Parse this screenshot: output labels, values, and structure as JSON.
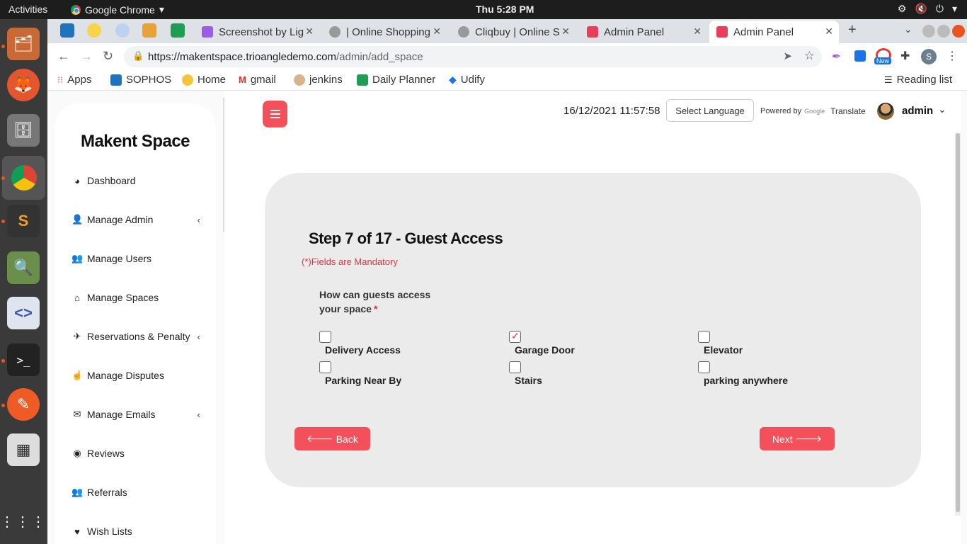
{
  "os": {
    "activities_label": "Activities",
    "app_name": "Google Chrome",
    "clock": "Thu  5:28 PM"
  },
  "browser": {
    "tabs": [
      {
        "label": "Screenshot by Lig"
      },
      {
        "label": "| Online Shopping"
      },
      {
        "label": "Cliqbuy | Online S"
      },
      {
        "label": "Admin Panel"
      },
      {
        "label": "Admin Panel"
      }
    ],
    "url_host": "https://makentspace.trioangledemo.com",
    "url_path": "/admin/add_space",
    "bookmarks": [
      {
        "label": "Apps"
      },
      {
        "label": "SOPHOS"
      },
      {
        "label": "Home"
      },
      {
        "label": "gmail"
      },
      {
        "label": "jenkins"
      },
      {
        "label": "Daily Planner"
      },
      {
        "label": "Udify"
      }
    ],
    "reading_list": "Reading list",
    "profile_initial": "S",
    "new_badge": "New"
  },
  "sidebar": {
    "brand": "Makent Space",
    "items": [
      {
        "label": "Dashboard",
        "icon": "dashboard-icon"
      },
      {
        "label": "Manage Admin",
        "icon": "user-plus-icon"
      },
      {
        "label": "Manage Users",
        "icon": "users-icon"
      },
      {
        "label": "Manage Spaces",
        "icon": "home-icon"
      },
      {
        "label": "Reservations & Penalty",
        "icon": "plane-icon"
      },
      {
        "label": "Manage Disputes",
        "icon": "hand-icon"
      },
      {
        "label": "Manage Emails",
        "icon": "envelope-icon"
      },
      {
        "label": "Reviews",
        "icon": "eye-icon"
      },
      {
        "label": "Referrals",
        "icon": "users-icon"
      },
      {
        "label": "Wish Lists",
        "icon": "heart-icon"
      }
    ]
  },
  "header": {
    "datetime": "16/12/2021 11:57:58",
    "select_language": "Select Language",
    "powered_by": "Powered by",
    "google": "Google",
    "translate": "Translate",
    "admin_name": "admin"
  },
  "form": {
    "step_title": "Step 7 of 17 - Guest Access",
    "mandatory_note": "(*)Fields are Mandatory",
    "question": "How can guests access your space",
    "required_mark": "*",
    "options": [
      {
        "label": "Delivery Access",
        "checked": false
      },
      {
        "label": "Garage Door",
        "checked": true
      },
      {
        "label": "Elevator",
        "checked": false
      },
      {
        "label": "Parking Near By",
        "checked": false
      },
      {
        "label": "Stairs",
        "checked": false
      },
      {
        "label": "parking anywhere",
        "checked": false
      }
    ],
    "back_label": "Back",
    "next_label": "Next"
  },
  "colors": {
    "accent": "#f4505b",
    "card_bg": "#ebebeb",
    "required": "#e0323d"
  }
}
